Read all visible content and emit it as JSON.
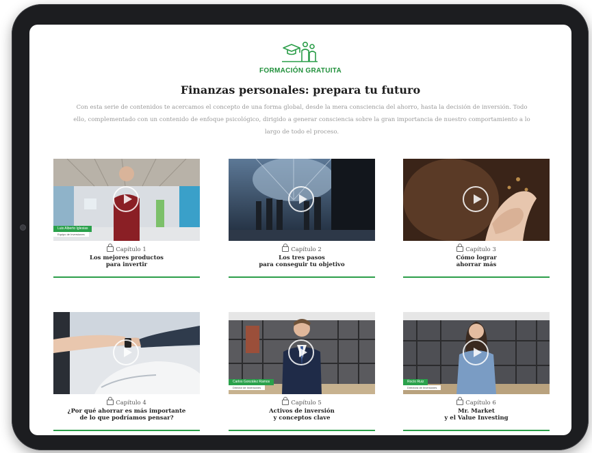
{
  "header": {
    "kicker": "FORMACIÓN GRATUITA",
    "title": "Finanzas personales: prepara tu futuro",
    "description": "Con esta serie de contenidos te acercamos el concepto de una forma global, desde la mera consciencia del ahorro, hasta la decisión de inversión. Todo ello, complementado con un contenido de enfoque psicológico, dirigido a generar consciencia sobre la gran importancia de nuestro comportamiento a lo largo de todo el proceso."
  },
  "colors": {
    "accent": "#1f8f3a",
    "bar": "#2a9d48"
  },
  "chapters": [
    {
      "chapter": "Capítulo 1",
      "title1": "Los mejores productos",
      "title2": "para invertir",
      "lower_name": "Luis Alberto Iglesias",
      "lower_role": "Equipo de Inversiones"
    },
    {
      "chapter": "Capítulo 2",
      "title1": "Los tres pasos",
      "title2": "para conseguir tu objetivo"
    },
    {
      "chapter": "Capítulo 3",
      "title1": "Cómo lograr",
      "title2": "ahorrar más"
    },
    {
      "chapter": "Capítulo 4",
      "title1": "¿Por qué ahorrar es más importante",
      "title2": "de lo que podríamos pensar?"
    },
    {
      "chapter": "Capítulo 5",
      "title1": "Activos de inversión",
      "title2": "y conceptos clave",
      "lower_name": "Carlos González Ramos",
      "lower_role": "Director de Inversiones"
    },
    {
      "chapter": "Capítulo 6",
      "title1": "Mr. Market",
      "title2": "y el Value Investing",
      "lower_name": "Rocío Ruiz",
      "lower_role": "Directora de Inversiones"
    }
  ]
}
